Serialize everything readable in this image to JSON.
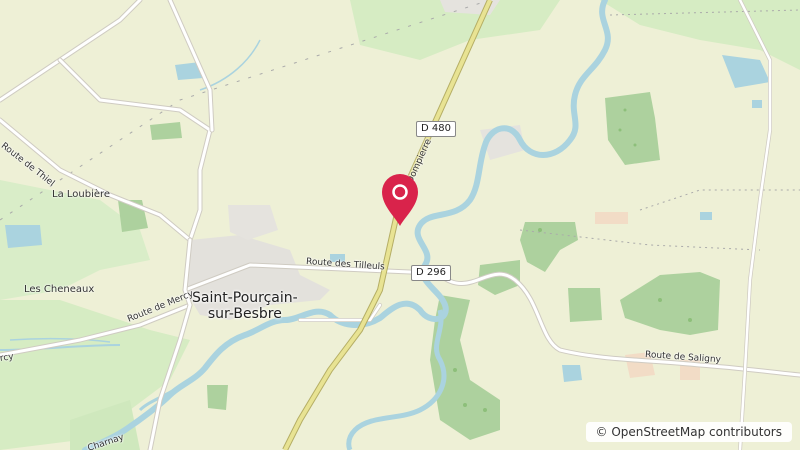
{
  "map": {
    "place_labels": {
      "town": "Saint-Pourçain-\nsur-Besbre",
      "hamlet_1": "La Loubière",
      "hamlet_2": "Les Cheneaux"
    },
    "road_labels": {
      "thiel": "Route de Thiel",
      "mercy": "Route de Mercy",
      "mercy_left": "rcy",
      "tilleuls": "Route des Tilleuls",
      "dompierre": "Dompierre",
      "saligny": "Route de Saligny",
      "charnay": "Charnay"
    },
    "shields": {
      "d480": "D 480",
      "d296": "D 296"
    },
    "attribution": "© OpenStreetMap contributors",
    "marker": {
      "icon": "map-pin-icon",
      "color": "#d9234b"
    },
    "colors": {
      "land": "#eef0d6",
      "forest": "#cfe8bd",
      "forest_dark": "#add19e",
      "water": "#aad3df",
      "primary_road": "#e8e393"
    }
  }
}
